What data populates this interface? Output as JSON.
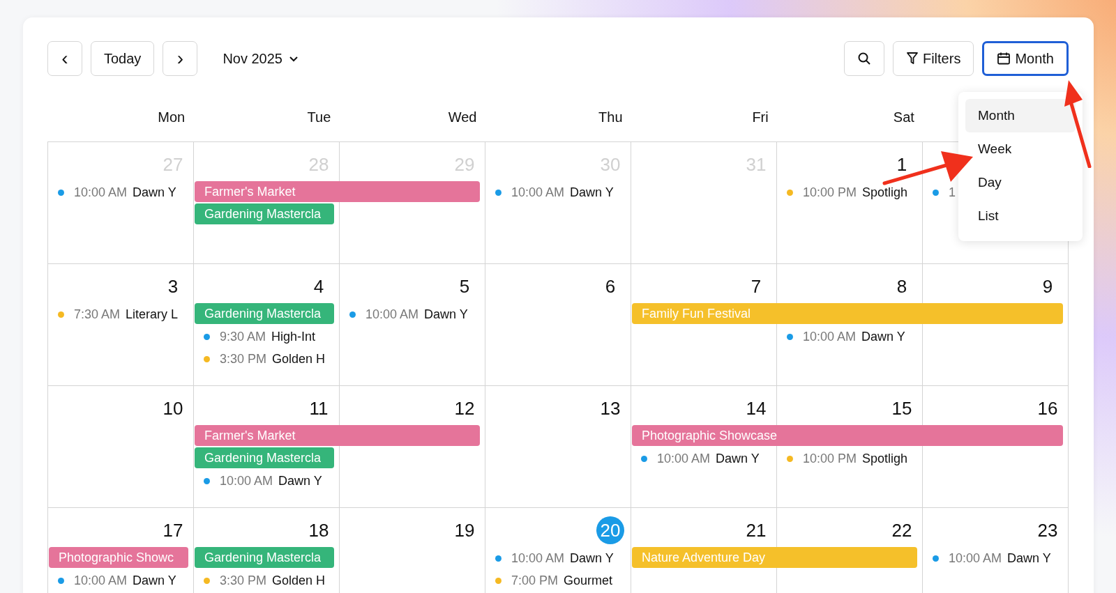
{
  "toolbar": {
    "prev": "‹",
    "today": "Today",
    "next": "›",
    "period": "Nov 2025",
    "filters": "Filters",
    "view_button": {
      "label": "Month",
      "open": true
    }
  },
  "view_menu": [
    {
      "label": "Month",
      "selected": true
    },
    {
      "label": "Week",
      "selected": false
    },
    {
      "label": "Day",
      "selected": false
    },
    {
      "label": "List",
      "selected": false
    }
  ],
  "weekdays": [
    "Mon",
    "Tue",
    "Wed",
    "Thu",
    "Fri",
    "Sat"
  ],
  "weeks": [
    {
      "days": [
        {
          "day": "27",
          "muted": true,
          "today": false,
          "events": [
            {
              "color": "#1a9be6",
              "time": "10:00 AM",
              "title": "Dawn Y"
            }
          ]
        },
        {
          "day": "28",
          "muted": true,
          "today": false,
          "bars": [
            {
              "title": "Farmer's Market",
              "color": "#e5749a",
              "continued": false
            },
            {
              "title": "Gardening Mastercla",
              "color": "#35b57a",
              "continued": false
            }
          ]
        },
        {
          "day": "29",
          "muted": true,
          "today": false,
          "bars": [
            {
              "continued": true
            }
          ]
        },
        {
          "day": "30",
          "muted": true,
          "today": false,
          "events": [
            {
              "color": "#1a9be6",
              "time": "10:00 AM",
              "title": "Dawn Y"
            }
          ]
        },
        {
          "day": "31",
          "muted": true,
          "today": false
        },
        {
          "day": "1",
          "muted": false,
          "today": false,
          "events": [
            {
              "color": "#f5b922",
              "time": "10:00 PM",
              "title": "Spotligh"
            }
          ]
        },
        {
          "muted": false,
          "today": false,
          "events": [
            {
              "color": "#1a9be6",
              "time": "1"
            }
          ]
        }
      ]
    },
    {
      "days": [
        {
          "day": "3",
          "muted": false,
          "today": false,
          "events": [
            {
              "color": "#f5b922",
              "time": "7:30 AM",
              "title": "Literary L"
            }
          ]
        },
        {
          "day": "4",
          "muted": false,
          "today": false,
          "bars": [
            {
              "title": "Gardening Mastercla",
              "color": "#35b57a",
              "continued": false
            }
          ],
          "events": [
            {
              "color": "#1a9be6",
              "time": "9:30 AM",
              "title": "High-Int"
            },
            {
              "color": "#f5b922",
              "time": "3:30 PM",
              "title": "Golden H"
            }
          ]
        },
        {
          "day": "5",
          "muted": false,
          "today": false,
          "events": [
            {
              "color": "#1a9be6",
              "time": "10:00 AM",
              "title": "Dawn Y"
            }
          ]
        },
        {
          "day": "6",
          "muted": false,
          "today": false
        },
        {
          "day": "7",
          "muted": false,
          "today": false,
          "bars": [
            {
              "title": "Family Fun Festival",
              "color": "#f5c02a",
              "continued": false
            }
          ]
        },
        {
          "day": "8",
          "muted": false,
          "today": false,
          "bars": [
            {
              "continued": true
            }
          ],
          "events": [
            {
              "color": "#1a9be6",
              "time": "10:00 AM",
              "title": "Dawn Y"
            }
          ]
        },
        {
          "day": "9",
          "muted": false,
          "today": false,
          "bars": [
            {
              "continued": true
            }
          ]
        }
      ]
    },
    {
      "days": [
        {
          "day": "10",
          "muted": false,
          "today": false
        },
        {
          "day": "11",
          "muted": false,
          "today": false,
          "bars": [
            {
              "title": "Farmer's Market",
              "color": "#e5749a",
              "continued": false
            },
            {
              "title": "Gardening Mastercla",
              "color": "#35b57a",
              "continued": false
            }
          ],
          "events": [
            {
              "color": "#1a9be6",
              "time": "10:00 AM",
              "title": "Dawn Y"
            }
          ]
        },
        {
          "day": "12",
          "muted": false,
          "today": false,
          "bars": [
            {
              "continued": true
            }
          ]
        },
        {
          "day": "13",
          "muted": false,
          "today": false
        },
        {
          "day": "14",
          "muted": false,
          "today": false,
          "bars": [
            {
              "title": "Photographic Showcase",
              "color": "#e5749a",
              "continued": false
            }
          ],
          "events": [
            {
              "color": "#1a9be6",
              "time": "10:00 AM",
              "title": "Dawn Y"
            }
          ]
        },
        {
          "day": "15",
          "muted": false,
          "today": false,
          "bars": [
            {
              "continued": true
            }
          ],
          "events": [
            {
              "color": "#f5b922",
              "time": "10:00 PM",
              "title": "Spotligh"
            }
          ]
        },
        {
          "day": "16",
          "muted": false,
          "today": false,
          "bars": [
            {
              "continued": true
            }
          ]
        }
      ]
    },
    {
      "days": [
        {
          "day": "17",
          "muted": false,
          "today": false,
          "bars": [
            {
              "title": "Photographic Showc",
              "color": "#e5749a",
              "continued": false
            }
          ],
          "events": [
            {
              "color": "#1a9be6",
              "time": "10:00 AM",
              "title": "Dawn Y"
            }
          ]
        },
        {
          "day": "18",
          "muted": false,
          "today": false,
          "bars": [
            {
              "title": "Gardening Mastercla",
              "color": "#35b57a",
              "continued": false
            }
          ],
          "events": [
            {
              "color": "#f5b922",
              "time": "3:30 PM",
              "title": "Golden H"
            }
          ]
        },
        {
          "day": "19",
          "muted": false,
          "today": false
        },
        {
          "day": "20",
          "muted": false,
          "today": true,
          "events": [
            {
              "color": "#1a9be6",
              "time": "10:00 AM",
              "title": "Dawn Y"
            },
            {
              "color": "#f5b922",
              "time": "7:00 PM",
              "title": "Gourmet"
            }
          ]
        },
        {
          "day": "21",
          "muted": false,
          "today": false,
          "bars": [
            {
              "title": "Nature Adventure Day",
              "color": "#f5c02a",
              "continued": false
            }
          ]
        },
        {
          "day": "22",
          "muted": false,
          "today": false,
          "bars": [
            {
              "continued": true
            }
          ]
        },
        {
          "day": "23",
          "muted": false,
          "today": false,
          "events": [
            {
              "color": "#1a9be6",
              "time": "10:00 AM",
              "title": "Dawn Y"
            }
          ]
        }
      ]
    }
  ]
}
